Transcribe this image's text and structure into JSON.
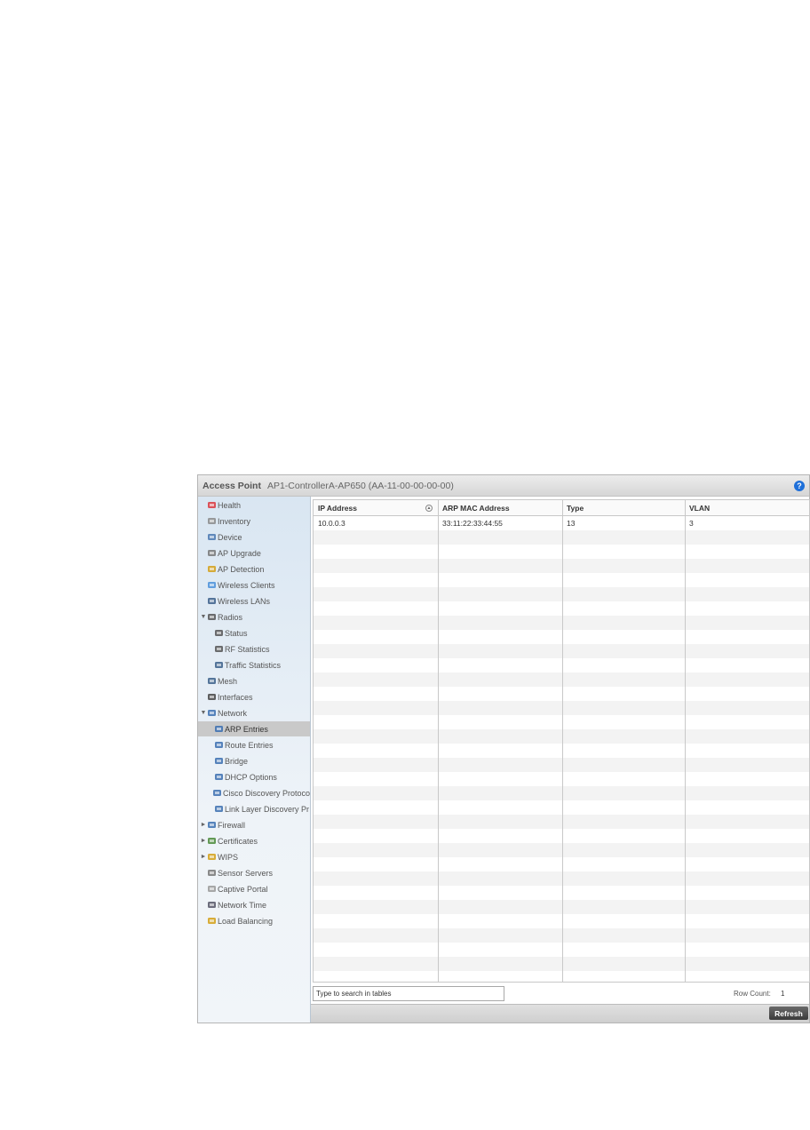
{
  "window": {
    "title": "Access Point",
    "subtitle": "AP1-ControllerA-AP650 (AA-11-00-00-00-00)",
    "help_icon": "?"
  },
  "sidebar": {
    "items": [
      {
        "label": "Health",
        "icon": "health-icon",
        "level": 0,
        "arrow": ""
      },
      {
        "label": "Inventory",
        "icon": "inventory-icon",
        "level": 0,
        "arrow": ""
      },
      {
        "label": "Device",
        "icon": "device-icon",
        "level": 0,
        "arrow": ""
      },
      {
        "label": "AP Upgrade",
        "icon": "ap-upgrade-icon",
        "level": 0,
        "arrow": ""
      },
      {
        "label": "AP Detection",
        "icon": "ap-detection-icon",
        "level": 0,
        "arrow": ""
      },
      {
        "label": "Wireless Clients",
        "icon": "wireless-clients-icon",
        "level": 0,
        "arrow": ""
      },
      {
        "label": "Wireless LANs",
        "icon": "wireless-lans-icon",
        "level": 0,
        "arrow": ""
      },
      {
        "label": "Radios",
        "icon": "radio-icon",
        "level": 0,
        "arrow": "▼"
      },
      {
        "label": "Status",
        "icon": "antenna-icon",
        "level": 1,
        "arrow": ""
      },
      {
        "label": "RF Statistics",
        "icon": "antenna-icon",
        "level": 1,
        "arrow": ""
      },
      {
        "label": "Traffic Statistics",
        "icon": "traffic-icon",
        "level": 1,
        "arrow": ""
      },
      {
        "label": "Mesh",
        "icon": "mesh-icon",
        "level": 0,
        "arrow": ""
      },
      {
        "label": "Interfaces",
        "icon": "interfaces-icon",
        "level": 0,
        "arrow": ""
      },
      {
        "label": "Network",
        "icon": "network-icon",
        "level": 0,
        "arrow": "▼"
      },
      {
        "label": "ARP Entries",
        "icon": "table-icon",
        "level": 1,
        "arrow": "",
        "selected": true
      },
      {
        "label": "Route Entries",
        "icon": "table-icon",
        "level": 1,
        "arrow": ""
      },
      {
        "label": "Bridge",
        "icon": "bridge-icon",
        "level": 1,
        "arrow": ""
      },
      {
        "label": "DHCP Options",
        "icon": "dhcp-icon",
        "level": 1,
        "arrow": ""
      },
      {
        "label": "Cisco Discovery Protoco",
        "icon": "dhcp-icon",
        "level": 1,
        "arrow": ""
      },
      {
        "label": "Link Layer Discovery Pr",
        "icon": "dhcp-icon",
        "level": 1,
        "arrow": ""
      },
      {
        "label": "Firewall",
        "icon": "firewall-icon",
        "level": 0,
        "arrow": "►"
      },
      {
        "label": "Certificates",
        "icon": "certificates-icon",
        "level": 0,
        "arrow": "►"
      },
      {
        "label": "WIPS",
        "icon": "wips-icon",
        "level": 0,
        "arrow": "►"
      },
      {
        "label": "Sensor Servers",
        "icon": "sensor-icon",
        "level": 0,
        "arrow": ""
      },
      {
        "label": "Captive Portal",
        "icon": "portal-icon",
        "level": 0,
        "arrow": ""
      },
      {
        "label": "Network Time",
        "icon": "clock-icon",
        "level": 0,
        "arrow": ""
      },
      {
        "label": "Load Balancing",
        "icon": "balance-icon",
        "level": 0,
        "arrow": ""
      }
    ]
  },
  "table": {
    "columns": [
      "IP Address",
      "ARP MAC Address",
      "Type",
      "VLAN"
    ],
    "rows": [
      [
        "10.0.0.3",
        "33:11:22:33:44:55",
        "13",
        "3"
      ]
    ]
  },
  "search": {
    "placeholder": "Type to search in tables"
  },
  "row_count": {
    "label": "Row Count:",
    "value": "1"
  },
  "footer": {
    "refresh_label": "Refresh"
  },
  "colors": {
    "selected_row": "#c9c9c9",
    "sidebar_bg": "#d9e6f2",
    "help_blue": "#1e6fd9"
  }
}
